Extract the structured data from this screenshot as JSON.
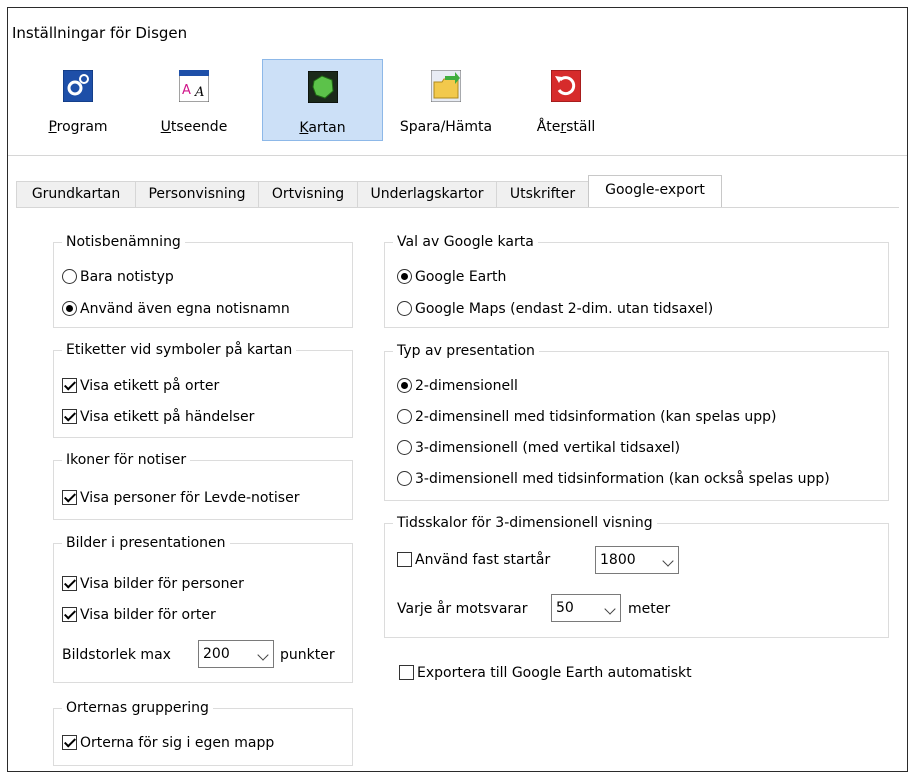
{
  "window": {
    "title": "Inställningar för Disgen"
  },
  "toolbar": [
    {
      "label": "Program",
      "icon": "gears-icon"
    },
    {
      "label": "Utseende",
      "icon": "font-icon"
    },
    {
      "label": "Kartan",
      "icon": "map-icon"
    },
    {
      "label": "Spara/Hämta",
      "icon": "folder-icon"
    },
    {
      "label": "Återställ",
      "icon": "undo-icon"
    }
  ],
  "tabs": [
    "Grundkartan",
    "Personvisning",
    "Ortvisning",
    "Underlagskartor",
    "Utskrifter",
    "Google-export"
  ],
  "active_tab": "Google-export",
  "notis": {
    "legend": "Notisbenämning",
    "opt1": "Bara notistyp",
    "opt2": "Använd även egna notisnamn"
  },
  "etiketter": {
    "legend": "Etiketter vid symboler på kartan",
    "chk1": "Visa etikett på orter",
    "chk2": "Visa etikett på händelser"
  },
  "ikoner": {
    "legend": "Ikoner för notiser",
    "chk1": "Visa personer för Levde-notiser"
  },
  "bilder": {
    "legend": "Bilder i presentationen",
    "chk1": "Visa bilder för personer",
    "chk2": "Visa bilder för orter",
    "size_label": "Bildstorlek  max",
    "size_value": "200",
    "size_unit": "punkter"
  },
  "gruppering": {
    "legend": "Orternas gruppering",
    "chk1": "Orterna för sig i egen mapp"
  },
  "google": {
    "legend": "Val av Google karta",
    "opt1": "Google Earth",
    "opt2": "Google Maps (endast 2-dim. utan tidsaxel)"
  },
  "presentation": {
    "legend": "Typ av presentation",
    "opt1": "2-dimensionell",
    "opt2": "2-dimensinell med tidsinformation (kan spelas upp)",
    "opt3": "3-dimensionell (med vertikal tidsaxel)",
    "opt4": "3-dimensionell med tidsinformation (kan också spelas upp)"
  },
  "tidsskalor": {
    "legend": "Tidsskalor för 3-dimensionell visning",
    "chk1": "Använd fast startår",
    "start_value": "1800",
    "year_label": "Varje år motsvarar",
    "year_value": "50",
    "year_unit": "meter"
  },
  "export": {
    "chk": "Exportera till Google Earth automatiskt"
  },
  "colors": {
    "active_tool_bg": "#cce0f7",
    "border": "#dcdcdc"
  }
}
